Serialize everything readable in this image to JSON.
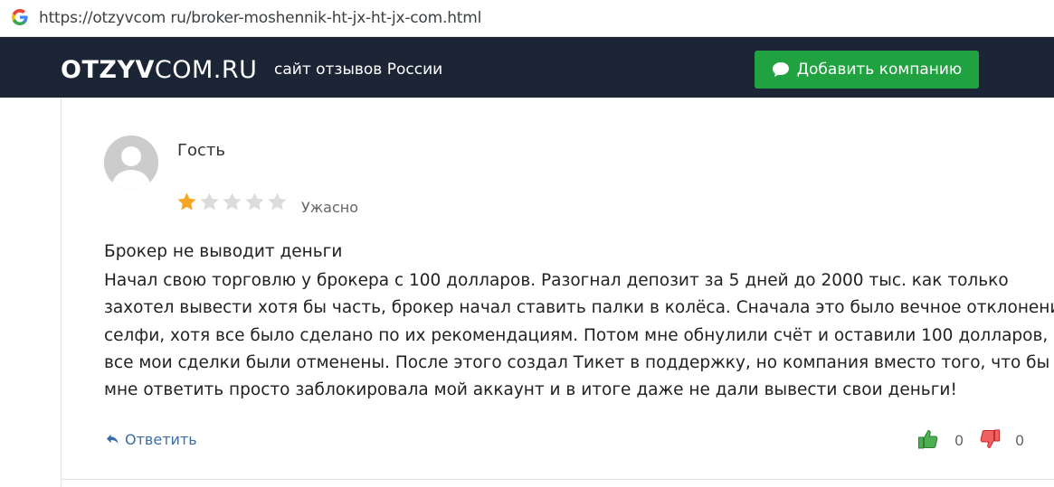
{
  "browser": {
    "url": "https://otzyvcom ru/broker-moshennik-ht-jx-ht-jx-com.html",
    "icon": "google-g-icon"
  },
  "header": {
    "logo_bold": "OTZYV",
    "logo_thin": "COM.RU",
    "tagline": "сайт отзывов России",
    "add_company_label": "Добавить компанию",
    "add_company_icon": "chat-bubble-icon",
    "bg_color": "#1b2535",
    "button_color": "#1fa23f"
  },
  "review": {
    "author": "Гость",
    "rating": 1,
    "rating_max": 5,
    "rating_label": "Ужасно",
    "star_color": "#f5a623",
    "title": "Брокер не выводит деньги",
    "body_lines": [
      "Начал свою торговлю у брокера с 100 долларов. Разогнал депозит за 5 дней до 2000 тыс. как только",
      "захотел вывести хотя бы часть, брокер начал ставить палки в колёса. Сначала это было вечное отклонение",
      "селфи, хотя все было сделано по их рекомендациям. Потом мне обнулили счёт и оставили 100 долларов,",
      "все мои сделки были отменены. После этого создал Тикет в поддержку, но компания вместо того, что бы",
      "мне ответить просто заблокировала мой аккаунт и в итоге даже не дали вывести свои деньги!"
    ],
    "reply_label": "Ответить",
    "likes": "0",
    "dislikes": "0"
  }
}
